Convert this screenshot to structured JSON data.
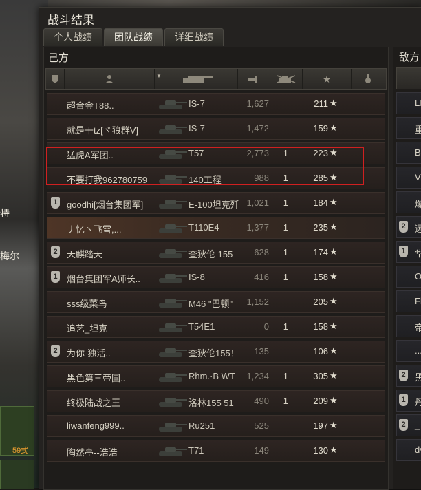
{
  "window": {
    "title": "战斗结果"
  },
  "tabs": [
    {
      "label": "个人战绩",
      "active": false
    },
    {
      "label": "团队战绩",
      "active": true
    },
    {
      "label": "详细战绩",
      "active": false
    }
  ],
  "background": {
    "labels": [
      "特",
      "梅尔"
    ],
    "badge": "59式"
  },
  "team_left": {
    "title": "己方",
    "header_icons": [
      "badge-column-icon",
      "player-icon",
      "tank-icon",
      "damage-icon",
      "kills-icon",
      "star-icon",
      "medal-icon"
    ],
    "rows": [
      {
        "badge": "",
        "name": "超合金T88..",
        "tank": "IS-7",
        "damage": "1,627",
        "kills": "",
        "exp": "211"
      },
      {
        "badge": "",
        "name": "就是干tz[ヾ狼群V]",
        "tank": "IS-7",
        "damage": "1,472",
        "kills": "",
        "exp": "159"
      },
      {
        "badge": "",
        "name": "猛虎A军团..",
        "tank": "T57",
        "damage": "2,773",
        "kills": "1",
        "exp": "223"
      },
      {
        "badge": "",
        "name": "不要打我962780759",
        "tank": "140工程",
        "damage": "988",
        "kills": "1",
        "exp": "285"
      },
      {
        "badge": "1",
        "name": "goodhi[烟台集团军]",
        "tank": "E-100坦克歼",
        "damage": "1,021",
        "kills": "1",
        "exp": "184"
      },
      {
        "badge": "",
        "name": "丿忆丶飞雪,...",
        "tank": "T110E4",
        "damage": "1,377",
        "kills": "1",
        "exp": "235",
        "highlight": true
      },
      {
        "badge": "2",
        "name": "天麒踏天",
        "tank": "查狄伦 155",
        "damage": "628",
        "kills": "1",
        "exp": "174"
      },
      {
        "badge": "1",
        "name": "烟台集团军A师长..",
        "tank": "IS-8",
        "damage": "416",
        "kills": "1",
        "exp": "158"
      },
      {
        "badge": "",
        "name": "sss级菜鸟",
        "tank": "M46 \"巴顿\"",
        "damage": "1,152",
        "kills": "",
        "exp": "205"
      },
      {
        "badge": "",
        "name": "追艺_坦克",
        "tank": "T54E1",
        "damage": "0",
        "kills": "1",
        "exp": "158"
      },
      {
        "badge": "2",
        "name": "为你-独活..",
        "tank": "查狄伦155！",
        "damage": "135",
        "kills": "",
        "exp": "106"
      },
      {
        "badge": "",
        "name": "黑色第三帝国..",
        "tank": "Rhm.·B WT",
        "damage": "1,234",
        "kills": "1",
        "exp": "305"
      },
      {
        "badge": "",
        "name": "终极陆战之王",
        "tank": "洛林155 51",
        "damage": "490",
        "kills": "1",
        "exp": "209"
      },
      {
        "badge": "",
        "name": "liwanfeng999..",
        "tank": "Ru251",
        "damage": "525",
        "kills": "",
        "exp": "197"
      },
      {
        "badge": "",
        "name": "陶然亭--浩浩",
        "tank": "T71",
        "damage": "149",
        "kills": "",
        "exp": "130"
      }
    ]
  },
  "team_right": {
    "title": "敌方",
    "rows": [
      {
        "badge": "",
        "name": "LI"
      },
      {
        "badge": "",
        "name": "重"
      },
      {
        "badge": "",
        "name": "BJ"
      },
      {
        "badge": "",
        "name": "Vi"
      },
      {
        "badge": "",
        "name": "爆"
      },
      {
        "badge": "2",
        "name": "远"
      },
      {
        "badge": "1",
        "name": "华"
      },
      {
        "badge": "",
        "name": "O"
      },
      {
        "badge": "",
        "name": "Fl"
      },
      {
        "badge": "",
        "name": "帝"
      },
      {
        "badge": "",
        "name": "..."
      },
      {
        "badge": "2",
        "name": "黑"
      },
      {
        "badge": "1",
        "name": "丹"
      },
      {
        "badge": "2",
        "name": "_"
      },
      {
        "badge": "",
        "name": "dv"
      }
    ]
  }
}
